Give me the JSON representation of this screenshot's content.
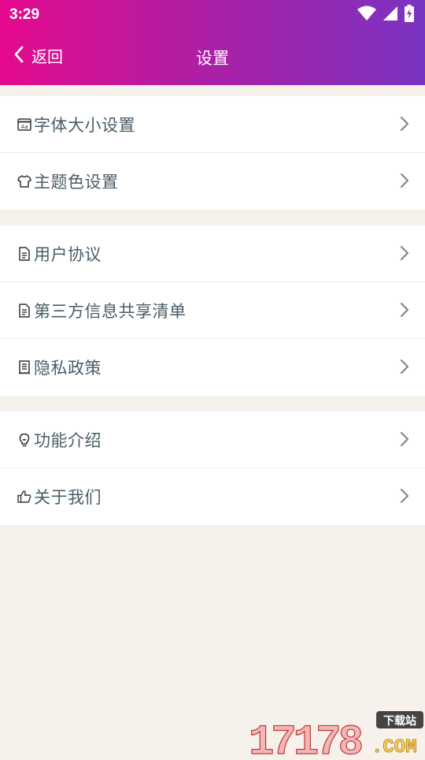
{
  "status": {
    "time": "3:29",
    "icons": [
      "wifi-icon",
      "signal-icon",
      "battery-charging-icon"
    ]
  },
  "nav": {
    "back_label": "返回",
    "title": "设置"
  },
  "groups": [
    {
      "items": [
        {
          "label": "字体大小设置",
          "icon": "font-size-icon"
        },
        {
          "label": "主题色设置",
          "icon": "tshirt-icon"
        }
      ]
    },
    {
      "items": [
        {
          "label": "用户协议",
          "icon": "document-icon"
        },
        {
          "label": "第三方信息共享清单",
          "icon": "document-icon"
        },
        {
          "label": "隐私政策",
          "icon": "receipt-icon"
        }
      ]
    },
    {
      "items": [
        {
          "label": "功能介绍",
          "icon": "lightbulb-icon"
        },
        {
          "label": "关于我们",
          "icon": "thumbs-up-icon"
        }
      ]
    }
  ],
  "watermark": {
    "number": "17178",
    "domain": ".COM",
    "tag": "下载站"
  },
  "colors": {
    "header_start": "#e50a8e",
    "header_end": "#7a33c2",
    "background": "#f6f2eb",
    "label_text": "#4a5d66",
    "chevron": "#7d8a90"
  }
}
